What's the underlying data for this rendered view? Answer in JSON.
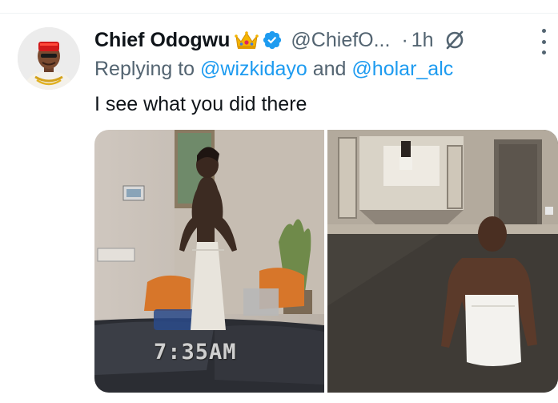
{
  "tweet": {
    "display_name": "Chief Odogwu",
    "handle": "@ChiefO...",
    "separator": "·",
    "time_ago": "1h",
    "reply_prefix": "Replying to",
    "reply_mention_1": "@wizkidayo",
    "reply_and": "and",
    "reply_mention_2": "@holar_alc",
    "text": "I see what you did there",
    "media_left_timestamp": "7:35AM"
  },
  "icons": {
    "crown": "crown-emoji-icon",
    "verified": "verified-badge-icon",
    "grok": "grok-icon",
    "more": "more-options-icon"
  },
  "colors": {
    "text_primary": "#0f1419",
    "text_secondary": "#536471",
    "link": "#1d9bf0",
    "verified": "#1d9bf0"
  }
}
